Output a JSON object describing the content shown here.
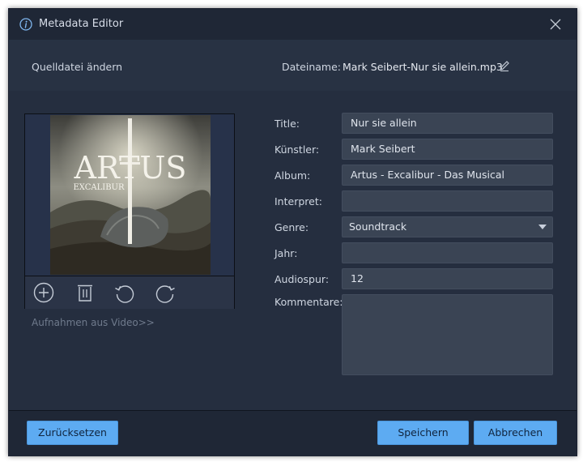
{
  "window": {
    "title": "Metadata Editor"
  },
  "source": {
    "change_label": "Quelldatei ändern",
    "filename_label": "Dateiname:",
    "filename_value": "Mark Seibert-Nur sie allein.mp3"
  },
  "cover": {
    "title_text": "ARTUS",
    "subtitle_text": "EXCALIBUR",
    "capture_link": "Aufnahmen aus Video>>"
  },
  "form": {
    "title_label": "Title:",
    "title_value": "Nur sie allein",
    "artist_label": "Künstler:",
    "artist_value": "Mark Seibert",
    "album_label": "Album:",
    "album_value": "Artus - Excalibur - Das Musical",
    "interpret_label": "Interpret:",
    "interpret_value": "",
    "genre_label": "Genre:",
    "genre_value": "Soundtrack",
    "year_label": "Jahr:",
    "year_value": "",
    "track_label": "Audiospur:",
    "track_value": "12",
    "comments_label": "Kommentare:"
  },
  "footer": {
    "reset_label": "Zurücksetzen",
    "save_label": "Speichern",
    "cancel_label": "Abbrechen"
  },
  "colors": {
    "accent": "#5dabf2",
    "background": "#252e3f",
    "field": "#3a4454"
  },
  "icons": [
    "info-icon",
    "close-icon",
    "edit-icon",
    "add-icon",
    "trash-icon",
    "rotate-left-icon",
    "rotate-right-icon",
    "chevron-down-icon"
  ]
}
